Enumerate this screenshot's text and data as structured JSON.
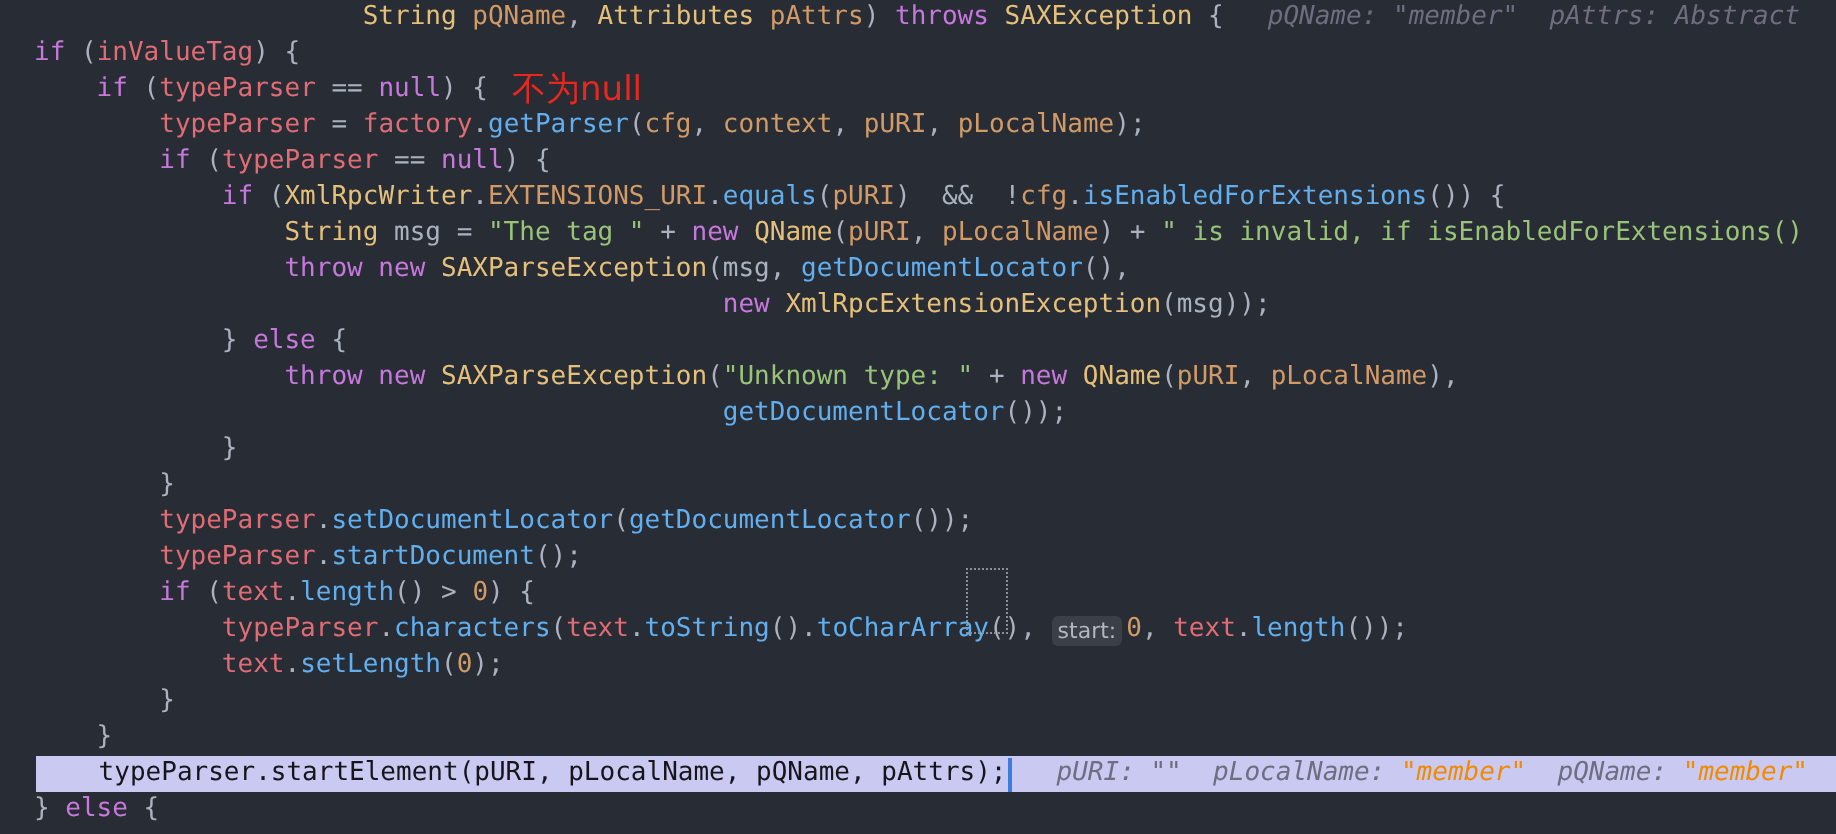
{
  "lines": [
    {
      "current": false,
      "segments": [
        {
          "kind": "code",
          "tokens": [
            {
              "text": "                     String ",
              "kind": "t"
            },
            {
              "text": "pQName",
              "kind": "n"
            },
            {
              "text": ", ",
              "kind": "p"
            },
            {
              "text": "Attributes ",
              "kind": "t"
            },
            {
              "text": "pAttrs",
              "kind": "n"
            },
            {
              "text": ") ",
              "kind": "p"
            },
            {
              "text": "throws ",
              "kind": "k"
            },
            {
              "text": "SAXException",
              "kind": "t"
            },
            {
              "text": " {",
              "kind": "p"
            }
          ]
        },
        {
          "kind": "debug",
          "tokens": [
            {
              "text": "pQName: ",
              "kind": "label"
            },
            {
              "text": "\"member\"",
              "kind": "dim"
            },
            {
              "text": "  pAttrs: Abstract",
              "kind": "label"
            }
          ]
        }
      ]
    },
    {
      "current": false,
      "segments": [
        {
          "kind": "code",
          "tokens": [
            {
              "text": "if",
              "kind": "k"
            },
            {
              "text": " (",
              "kind": "p"
            },
            {
              "text": "inValueTag",
              "kind": "v"
            },
            {
              "text": ") {",
              "kind": "p"
            }
          ]
        }
      ]
    },
    {
      "current": false,
      "segments": [
        {
          "kind": "code",
          "tokens": [
            {
              "text": "    if",
              "kind": "k"
            },
            {
              "text": " (",
              "kind": "p"
            },
            {
              "text": "typeParser",
              "kind": "v"
            },
            {
              "text": " == ",
              "kind": "p"
            },
            {
              "text": "null",
              "kind": "k"
            },
            {
              "text": ") {",
              "kind": "p"
            }
          ]
        },
        {
          "kind": "annotation",
          "text": "不为null"
        }
      ]
    },
    {
      "current": false,
      "segments": [
        {
          "kind": "code",
          "tokens": [
            {
              "text": "        typeParser",
              "kind": "v"
            },
            {
              "text": " = ",
              "kind": "p"
            },
            {
              "text": "factory",
              "kind": "v"
            },
            {
              "text": ".",
              "kind": "p"
            },
            {
              "text": "getParser",
              "kind": "m"
            },
            {
              "text": "(",
              "kind": "p"
            },
            {
              "text": "cfg",
              "kind": "n"
            },
            {
              "text": ", ",
              "kind": "p"
            },
            {
              "text": "context",
              "kind": "n"
            },
            {
              "text": ", ",
              "kind": "p"
            },
            {
              "text": "pURI",
              "kind": "n"
            },
            {
              "text": ", ",
              "kind": "p"
            },
            {
              "text": "pLocalName",
              "kind": "n"
            },
            {
              "text": ");",
              "kind": "p"
            }
          ]
        }
      ]
    },
    {
      "current": false,
      "segments": [
        {
          "kind": "code",
          "tokens": [
            {
              "text": "        if",
              "kind": "k"
            },
            {
              "text": " (",
              "kind": "p"
            },
            {
              "text": "typeParser",
              "kind": "v"
            },
            {
              "text": " == ",
              "kind": "p"
            },
            {
              "text": "null",
              "kind": "k"
            },
            {
              "text": ") {",
              "kind": "p"
            }
          ]
        }
      ]
    },
    {
      "current": false,
      "segments": [
        {
          "kind": "code",
          "tokens": [
            {
              "text": "            if",
              "kind": "k"
            },
            {
              "text": " (",
              "kind": "p"
            },
            {
              "text": "XmlRpcWriter",
              "kind": "t"
            },
            {
              "text": ".",
              "kind": "p"
            },
            {
              "text": "EXTENSIONS_URI",
              "kind": "n"
            },
            {
              "text": ".",
              "kind": "p"
            },
            {
              "text": "equals",
              "kind": "m"
            },
            {
              "text": "(",
              "kind": "p"
            },
            {
              "text": "pURI",
              "kind": "n"
            },
            {
              "text": ")  &&  !",
              "kind": "p"
            },
            {
              "text": "cfg",
              "kind": "n"
            },
            {
              "text": ".",
              "kind": "p"
            },
            {
              "text": "isEnabledForExtensions",
              "kind": "m"
            },
            {
              "text": "()) {",
              "kind": "p"
            }
          ]
        }
      ]
    },
    {
      "current": false,
      "segments": [
        {
          "kind": "code",
          "tokens": [
            {
              "text": "                String",
              "kind": "t"
            },
            {
              "text": " msg = ",
              "kind": "p"
            },
            {
              "text": "\"The tag \"",
              "kind": "s"
            },
            {
              "text": " + ",
              "kind": "p"
            },
            {
              "text": "new ",
              "kind": "k"
            },
            {
              "text": "QName",
              "kind": "t"
            },
            {
              "text": "(",
              "kind": "p"
            },
            {
              "text": "pURI",
              "kind": "n"
            },
            {
              "text": ", ",
              "kind": "p"
            },
            {
              "text": "pLocalName",
              "kind": "n"
            },
            {
              "text": ") + ",
              "kind": "p"
            },
            {
              "text": "\" is invalid, if isEnabledForExtensions()",
              "kind": "s"
            }
          ]
        }
      ]
    },
    {
      "current": false,
      "segments": [
        {
          "kind": "code",
          "tokens": [
            {
              "text": "                throw new ",
              "kind": "k"
            },
            {
              "text": "SAXParseException",
              "kind": "t"
            },
            {
              "text": "(msg, ",
              "kind": "p"
            },
            {
              "text": "getDocumentLocator",
              "kind": "m"
            },
            {
              "text": "(),",
              "kind": "p"
            }
          ]
        }
      ]
    },
    {
      "current": false,
      "segments": [
        {
          "kind": "code",
          "tokens": [
            {
              "text": "                                            new ",
              "kind": "k"
            },
            {
              "text": "XmlRpcExtensionException",
              "kind": "t"
            },
            {
              "text": "(msg));",
              "kind": "p"
            }
          ]
        }
      ]
    },
    {
      "current": false,
      "segments": [
        {
          "kind": "code",
          "tokens": [
            {
              "text": "            } ",
              "kind": "p"
            },
            {
              "text": "else",
              "kind": "k"
            },
            {
              "text": " {",
              "kind": "p"
            }
          ]
        }
      ]
    },
    {
      "current": false,
      "segments": [
        {
          "kind": "code",
          "tokens": [
            {
              "text": "                throw new ",
              "kind": "k"
            },
            {
              "text": "SAXParseException",
              "kind": "t"
            },
            {
              "text": "(",
              "kind": "p"
            },
            {
              "text": "\"Unknown type: \"",
              "kind": "s"
            },
            {
              "text": " + ",
              "kind": "p"
            },
            {
              "text": "new ",
              "kind": "k"
            },
            {
              "text": "QName",
              "kind": "t"
            },
            {
              "text": "(",
              "kind": "p"
            },
            {
              "text": "pURI",
              "kind": "n"
            },
            {
              "text": ", ",
              "kind": "p"
            },
            {
              "text": "pLocalName",
              "kind": "n"
            },
            {
              "text": "),",
              "kind": "p"
            }
          ]
        }
      ]
    },
    {
      "current": false,
      "segments": [
        {
          "kind": "code",
          "tokens": [
            {
              "text": "                                            getDocumentLocator",
              "kind": "m"
            },
            {
              "text": "());",
              "kind": "p"
            }
          ]
        }
      ]
    },
    {
      "current": false,
      "segments": [
        {
          "kind": "code",
          "tokens": [
            {
              "text": "            }",
              "kind": "p"
            }
          ]
        }
      ]
    },
    {
      "current": false,
      "segments": [
        {
          "kind": "code",
          "tokens": [
            {
              "text": "        }",
              "kind": "p"
            }
          ]
        }
      ]
    },
    {
      "current": false,
      "segments": [
        {
          "kind": "code",
          "tokens": [
            {
              "text": "        typeParser",
              "kind": "v"
            },
            {
              "text": ".",
              "kind": "p"
            },
            {
              "text": "setDocumentLocator",
              "kind": "m"
            },
            {
              "text": "(",
              "kind": "p"
            },
            {
              "text": "getDocumentLocator",
              "kind": "m"
            },
            {
              "text": "());",
              "kind": "p"
            }
          ]
        }
      ]
    },
    {
      "current": false,
      "segments": [
        {
          "kind": "code",
          "tokens": [
            {
              "text": "        typeParser",
              "kind": "v"
            },
            {
              "text": ".",
              "kind": "p"
            },
            {
              "text": "startDocument",
              "kind": "m"
            },
            {
              "text": "();",
              "kind": "p"
            }
          ]
        }
      ]
    },
    {
      "current": false,
      "segments": [
        {
          "kind": "code",
          "tokens": [
            {
              "text": "        if",
              "kind": "k"
            },
            {
              "text": " (",
              "kind": "p"
            },
            {
              "text": "text",
              "kind": "v"
            },
            {
              "text": ".",
              "kind": "p"
            },
            {
              "text": "length",
              "kind": "m"
            },
            {
              "text": "() > ",
              "kind": "p"
            },
            {
              "text": "0",
              "kind": "n"
            },
            {
              "text": ") {",
              "kind": "p"
            }
          ]
        }
      ]
    },
    {
      "current": false,
      "segments": [
        {
          "kind": "code",
          "tokens": [
            {
              "text": "            typeParser",
              "kind": "v"
            },
            {
              "text": ".",
              "kind": "p"
            },
            {
              "text": "characters",
              "kind": "m"
            },
            {
              "text": "(",
              "kind": "p"
            },
            {
              "text": "text",
              "kind": "v"
            },
            {
              "text": ".",
              "kind": "p"
            },
            {
              "text": "toString",
              "kind": "m"
            },
            {
              "text": "().",
              "kind": "p"
            },
            {
              "text": "toCharArray",
              "kind": "m"
            },
            {
              "text": "(), ",
              "kind": "p"
            }
          ]
        },
        {
          "kind": "param-hint",
          "text": "start:"
        },
        {
          "kind": "code",
          "tokens": [
            {
              "text": "0",
              "kind": "n"
            },
            {
              "text": ", ",
              "kind": "p"
            },
            {
              "text": "text",
              "kind": "v"
            },
            {
              "text": ".",
              "kind": "p"
            },
            {
              "text": "length",
              "kind": "m"
            },
            {
              "text": "());",
              "kind": "p"
            }
          ]
        }
      ]
    },
    {
      "current": false,
      "segments": [
        {
          "kind": "code",
          "tokens": [
            {
              "text": "            text",
              "kind": "v"
            },
            {
              "text": ".",
              "kind": "p"
            },
            {
              "text": "setLength",
              "kind": "m"
            },
            {
              "text": "(",
              "kind": "p"
            },
            {
              "text": "0",
              "kind": "n"
            },
            {
              "text": ");",
              "kind": "p"
            }
          ]
        }
      ]
    },
    {
      "current": false,
      "segments": [
        {
          "kind": "code",
          "tokens": [
            {
              "text": "        }",
              "kind": "p"
            }
          ]
        }
      ]
    },
    {
      "current": false,
      "segments": [
        {
          "kind": "code",
          "tokens": [
            {
              "text": "    }",
              "kind": "p"
            }
          ]
        }
      ]
    },
    {
      "current": true,
      "segments": [
        {
          "kind": "code",
          "tokens": [
            {
              "text": "    typeParser.startElement(pURI, pLocalName, pQName, pAttrs);",
              "kind": "p"
            }
          ]
        },
        {
          "kind": "debug",
          "tokens": [
            {
              "text": "pURI: ",
              "kind": "label"
            },
            {
              "text": "\"\"",
              "kind": "label"
            },
            {
              "text": "  pLocalName: ",
              "kind": "label"
            },
            {
              "text": "\"member\"",
              "kind": "value"
            },
            {
              "text": "  pQName: ",
              "kind": "label"
            },
            {
              "text": "\"member\"",
              "kind": "value"
            }
          ]
        }
      ]
    },
    {
      "current": false,
      "segments": [
        {
          "kind": "code",
          "tokens": [
            {
              "text": "} ",
              "kind": "p"
            },
            {
              "text": "else",
              "kind": "k"
            },
            {
              "text": " {",
              "kind": "p"
            }
          ]
        }
      ]
    }
  ]
}
